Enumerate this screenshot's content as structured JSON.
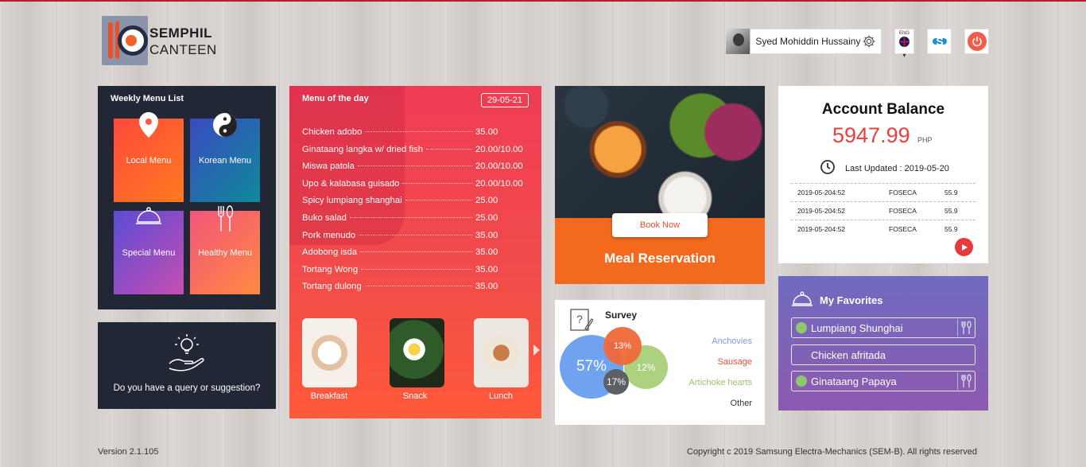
{
  "header": {
    "logo_line1": "SEMPHIL",
    "logo_line2": "CANTEEN",
    "user_name": "Syed Mohiddin Hussainy",
    "lang_label": "ENG"
  },
  "weekly_menu": {
    "title": "Weekly Menu List",
    "tiles": [
      {
        "label": "Local Menu"
      },
      {
        "label": "Korean Menu"
      },
      {
        "label": "Special Menu"
      },
      {
        "label": "Healthy Menu"
      }
    ]
  },
  "query": {
    "text": "Do you have a query or suggestion?"
  },
  "menu_of_day": {
    "title": "Menu of the day",
    "date": "29-05-21",
    "items": [
      {
        "name": "Chicken adobo",
        "price": "35.00"
      },
      {
        "name": "Ginataang langka w/ dried fish",
        "price": "20.00/10.00"
      },
      {
        "name": "Miswa patola",
        "price": "20.00/10.00"
      },
      {
        "name": "Upo & kalabasa guisado",
        "price": "20.00/10.00"
      },
      {
        "name": "Spicy lumpiang shanghai",
        "price": "25.00"
      },
      {
        "name": "Buko salad",
        "price": "25.00"
      },
      {
        "name": "Pork menudo",
        "price": "35.00"
      },
      {
        "name": "Adobong isda",
        "price": "35.00"
      },
      {
        "name": "Tortang Wong",
        "price": "35.00"
      },
      {
        "name": "Tortang dulong",
        "price": "35.00"
      }
    ],
    "meals": [
      {
        "label": "Breakfast"
      },
      {
        "label": "Snack"
      },
      {
        "label": "Lunch"
      }
    ]
  },
  "meal_reservation": {
    "button": "Book Now",
    "title": "Meal Reservation"
  },
  "survey": {
    "title": "Survey",
    "bubbles": [
      {
        "label": "57%",
        "value": 57,
        "color": "#6fa3f0"
      },
      {
        "label": "13%",
        "value": 13,
        "color": "#f0693a"
      },
      {
        "label": "12%",
        "value": 12,
        "color": "#a8d07a"
      },
      {
        "label": "17%",
        "value": 17,
        "color": "#5c5f66"
      }
    ],
    "legend": [
      "Anchovies",
      "Sausage",
      "Artichoke hearts",
      "Other"
    ]
  },
  "account": {
    "title": "Account Balance",
    "amount": "5947.99",
    "currency": "PHP",
    "last_updated": "Last Updated : 2019-05-20",
    "transactions": [
      {
        "date": "2019-05-204:52",
        "code": "FOSECA",
        "amount": "55.9"
      },
      {
        "date": "2019-05-204:52",
        "code": "FOSECA",
        "amount": "55.9"
      },
      {
        "date": "2019-05-204:52",
        "code": "FOSECA",
        "amount": "55.9"
      }
    ]
  },
  "favorites": {
    "title": "My Favorites",
    "items": [
      {
        "name": "Lumpiang Shunghai"
      },
      {
        "name": "Chicken afritada"
      },
      {
        "name": "Ginataang Papaya"
      }
    ]
  },
  "footer": {
    "version": "Version 2.1.105",
    "copyright": "Copyright c 2019 Samsung Electra-Mechanics (SEM-B). All rights reserved"
  },
  "colors": {
    "accent_red": "#e8413c",
    "panel_dark": "#222736",
    "meal_orange": "#f36a1f"
  }
}
